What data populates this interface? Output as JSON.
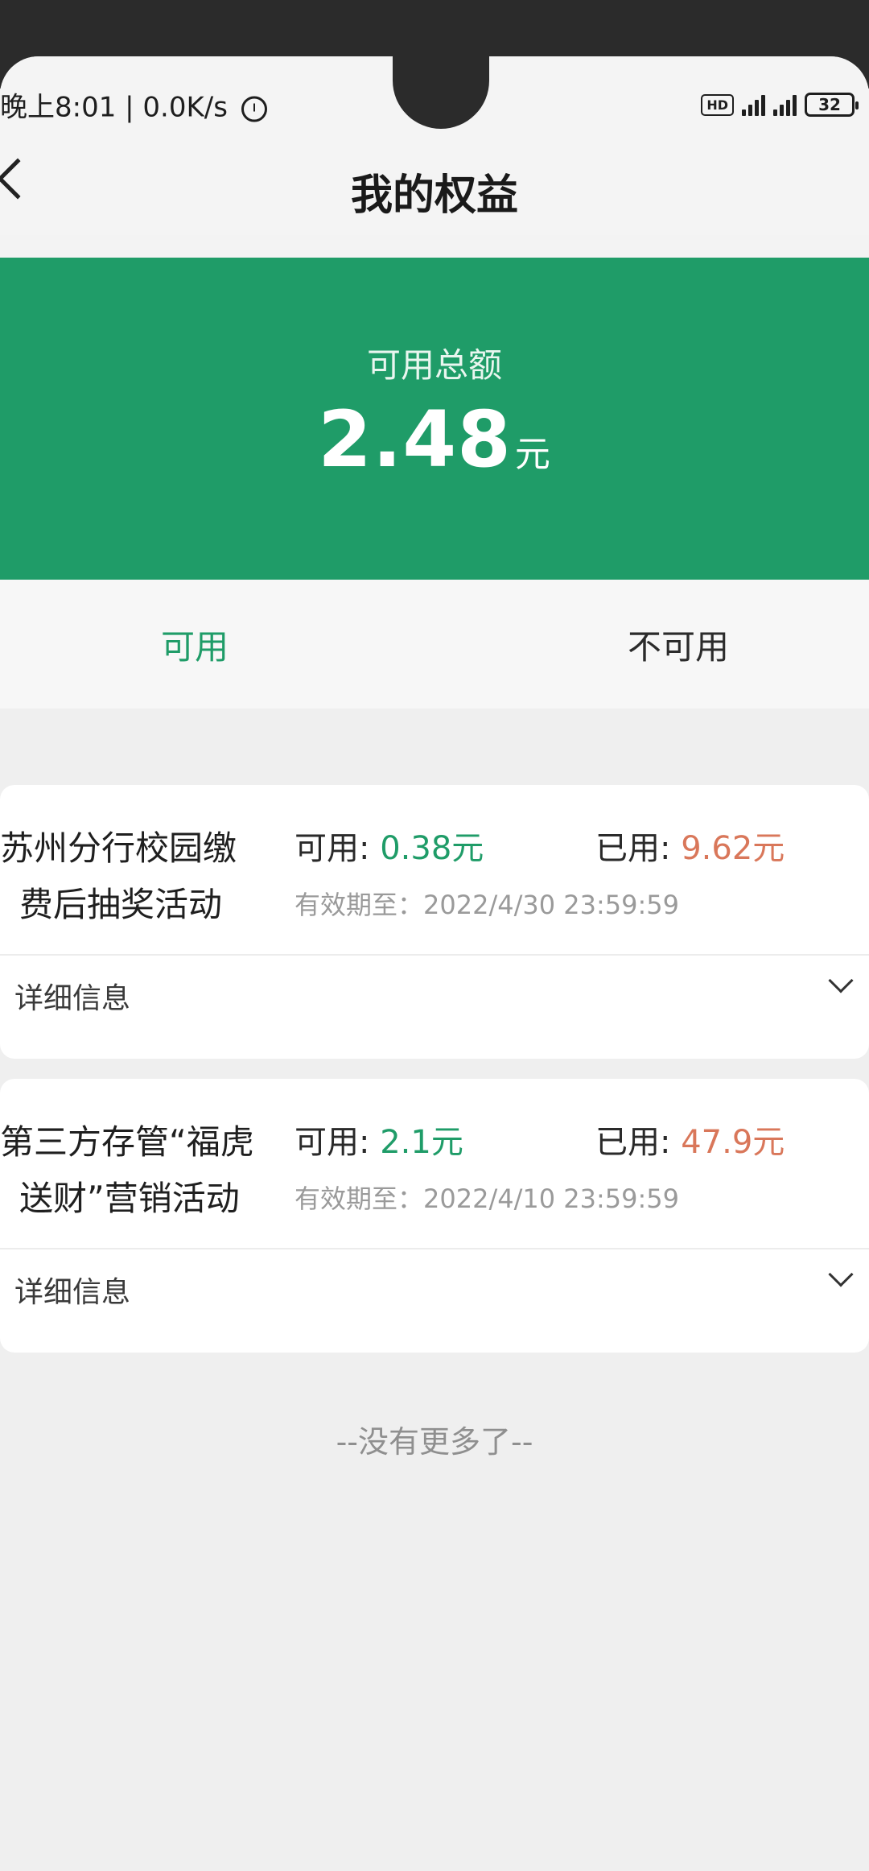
{
  "status_bar": {
    "time_and_speed": "晚上8:01 | 0.0K/s",
    "hd_label": "HD",
    "battery_level": "32"
  },
  "header": {
    "title": "我的权益"
  },
  "summary": {
    "label": "可用总额",
    "amount": "2.48",
    "unit": "元"
  },
  "tabs": [
    {
      "label": "可用",
      "active": true
    },
    {
      "label": "不可用",
      "active": false
    }
  ],
  "benefits": [
    {
      "name_line1": "苏州分行校园缴",
      "name_line2": "费后抽奖活动",
      "available_label": "可用: ",
      "available_value": "0.38元",
      "used_label": "已用: ",
      "used_value": "9.62元",
      "expiry": "有效期至：2022/4/30 23:59:59",
      "detail_label": "详细信息"
    },
    {
      "name_line1": "第三方存管“福虎",
      "name_line2": "送财”营销活动",
      "available_label": "可用: ",
      "available_value": "2.1元",
      "used_label": "已用: ",
      "used_value": "47.9元",
      "expiry": "有效期至：2022/4/10 23:59:59",
      "detail_label": "详细信息"
    }
  ],
  "footer": {
    "no_more": "--没有更多了--"
  },
  "colors": {
    "brand_green": "#1f9c68",
    "used_orange": "#d9775a"
  }
}
